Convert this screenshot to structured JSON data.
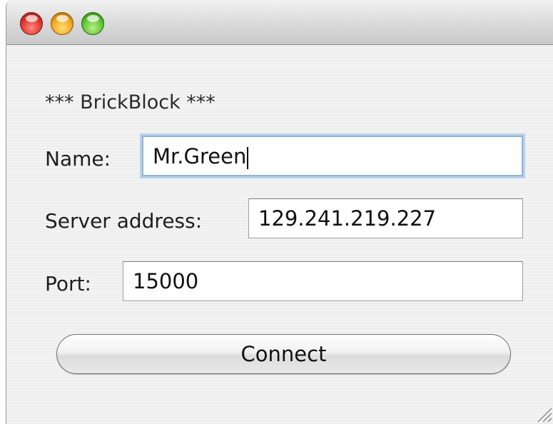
{
  "window": {
    "heading": "*** BrickBlock ***"
  },
  "form": {
    "name_label": "Name:",
    "name_value": "Mr.Green",
    "server_label": "Server address:",
    "server_value": "129.241.219.227",
    "port_label": "Port:",
    "port_value": "15000",
    "connect_label": "Connect"
  },
  "icons": {
    "close": "close-traffic-light-icon",
    "minimize": "minimize-traffic-light-icon",
    "zoom": "zoom-traffic-light-icon",
    "resize": "resize-grip-icon"
  },
  "colors": {
    "close": "#e0332c",
    "minimize": "#f2a41d",
    "zoom": "#5cc32f",
    "focus_ring": "#8fb3dd"
  }
}
